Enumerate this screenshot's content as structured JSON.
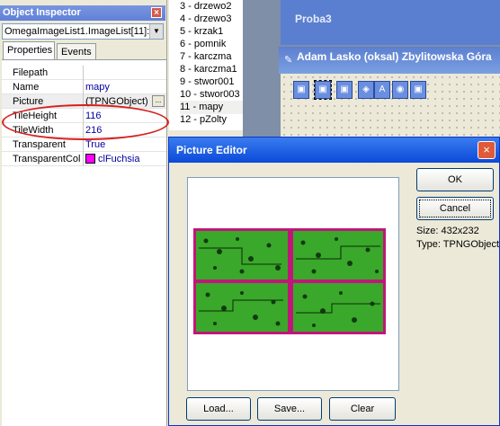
{
  "object_inspector": {
    "title": "Object Inspector",
    "close_icon": "×",
    "component_combo": "OmegaImageList1.ImageList[11]:",
    "tabs": [
      "Properties",
      "Events"
    ],
    "properties": [
      {
        "name": "Filepath",
        "value": ""
      },
      {
        "name": "Name",
        "value": "mapy"
      },
      {
        "name": "Picture",
        "value": "(TPNGObject)"
      },
      {
        "name": "TileHeight",
        "value": "116"
      },
      {
        "name": "TileWidth",
        "value": "216"
      },
      {
        "name": "Transparent",
        "value": "True"
      },
      {
        "name": "TransparentCol",
        "value": "clFuchsia"
      }
    ],
    "ellipsis": "...",
    "swatch_color": "#ff00ff",
    "highlight_color": "#d62020"
  },
  "image_list": {
    "items": [
      "3 - drzewo2",
      "4 - drzewo3",
      "5 - krzak1",
      "6 - pomnik",
      "7 - karczma",
      "8 - karczma1",
      "9 - stwor001",
      "10 - stwor003",
      "11 - mapy",
      "12 - pZolty"
    ],
    "selected_index": 8
  },
  "designer": {
    "probe_title": "Proba3",
    "caption": "Adam Lasko (oksal) Zbylitowska Góra"
  },
  "picture_editor": {
    "title": "Picture Editor",
    "close_icon": "×",
    "ok_label": "OK",
    "cancel_label": "Cancel",
    "size_text": "Size: 432x232",
    "type_text": "Type: TPNGObject",
    "load_label": "Load...",
    "save_label": "Save...",
    "clear_label": "Clear"
  },
  "colors": {
    "accent": "#0a4ad8",
    "tile_border": "#c0167a",
    "tile_fill": "#3aa82a"
  }
}
